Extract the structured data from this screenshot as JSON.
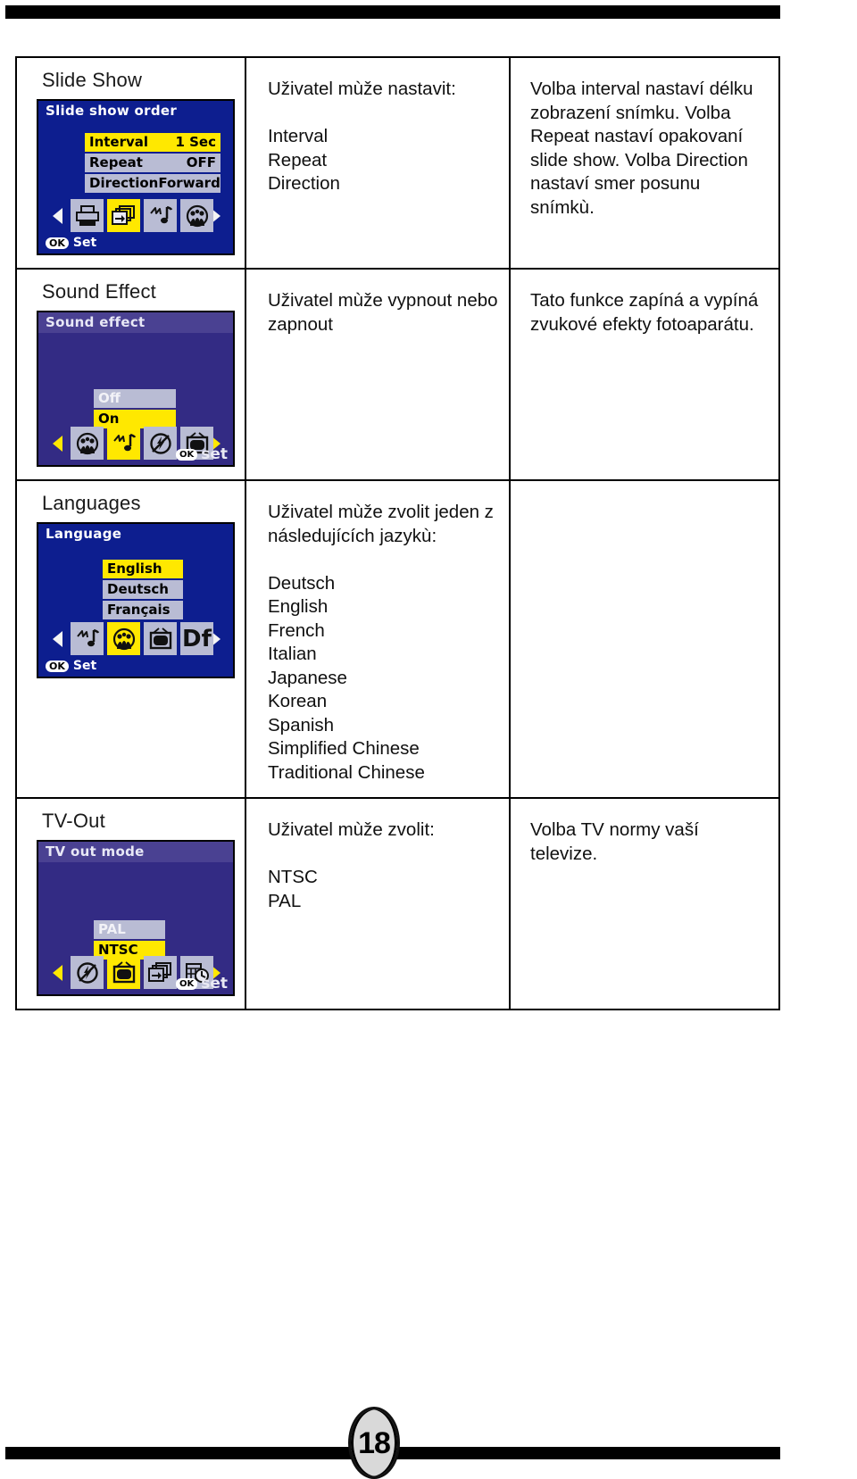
{
  "page": {
    "number": "18"
  },
  "table": {
    "rows": [
      {
        "label": "Slide Show",
        "mid_text": "Uživatel mùže nastavit:\n\nInterval\nRepeat\nDirection",
        "right_text": "Volba interval nastaví délku zobrazení snímku. Volba Repeat nastaví opakovaní slide show. Volba Direction nastaví smer posunu snímkù.",
        "screen": {
          "title": "Slide show order",
          "menu": [
            {
              "label": "Interval",
              "value": "1 Sec",
              "selected": true
            },
            {
              "label": "Repeat",
              "value": "OFF",
              "selected": false
            },
            {
              "label": "Direction",
              "value": "Forward",
              "selected": false
            }
          ],
          "icons": [
            "printer-icon",
            "slideshow-icon",
            "sound-icon",
            "language-icon"
          ],
          "selected_icon": "slideshow-icon",
          "footer": "Set",
          "footer_badge": "OK"
        }
      },
      {
        "label": "Sound Effect",
        "mid_text": "Uživatel mùže vypnout nebo zapnout",
        "right_text": "Tato funkce zapíná a vypíná zvukové efekty fotoaparátu.",
        "screen": {
          "title": "Sound effect",
          "menu": [
            {
              "label": "Off",
              "value": "",
              "selected": false
            },
            {
              "label": "On",
              "value": "",
              "selected": true
            }
          ],
          "icons": [
            "language-icon",
            "sound-icon",
            "flash-off-icon",
            "tv-icon"
          ],
          "selected_icon": "sound-icon",
          "footer": "set",
          "footer_badge": "OK"
        }
      },
      {
        "label": "Languages",
        "mid_text": "Uživatel mùže zvolit jeden z následujících jazykù:\n\nDeutsch\nEnglish\nFrench\nItalian\nJapanese\nKorean\nSpanish\nSimplified Chinese\nTraditional Chinese",
        "right_text": "",
        "screen": {
          "title": "Language",
          "menu": [
            {
              "label": "English",
              "value": "",
              "selected": true
            },
            {
              "label": "Deutsch",
              "value": "",
              "selected": false
            },
            {
              "label": "Français",
              "value": "",
              "selected": false
            }
          ],
          "icons": [
            "sound-icon",
            "language-icon",
            "tv-icon",
            "df-icon"
          ],
          "selected_icon": "language-icon",
          "footer": "Set",
          "footer_badge": "OK"
        }
      },
      {
        "label": "TV-Out",
        "mid_text": "Uživatel mùže zvolit:\n\nNTSC\nPAL",
        "right_text": "Volba TV normy vaší televize.",
        "screen": {
          "title": "TV out mode",
          "menu": [
            {
              "label": "PAL",
              "value": "",
              "selected": false
            },
            {
              "label": "NTSC",
              "value": "",
              "selected": true
            }
          ],
          "icons": [
            "flash-off-icon",
            "tv-icon",
            "slideshow-icon",
            "date-stamp-icon"
          ],
          "selected_icon": "tv-icon",
          "footer": "set",
          "footer_badge": "OK"
        }
      }
    ]
  },
  "colors": {
    "lcd_blue": "#0d1e8f",
    "lcd_violet": "#332b84",
    "highlight_yellow": "#ffe800",
    "row_gray": "#b9bcd4"
  }
}
